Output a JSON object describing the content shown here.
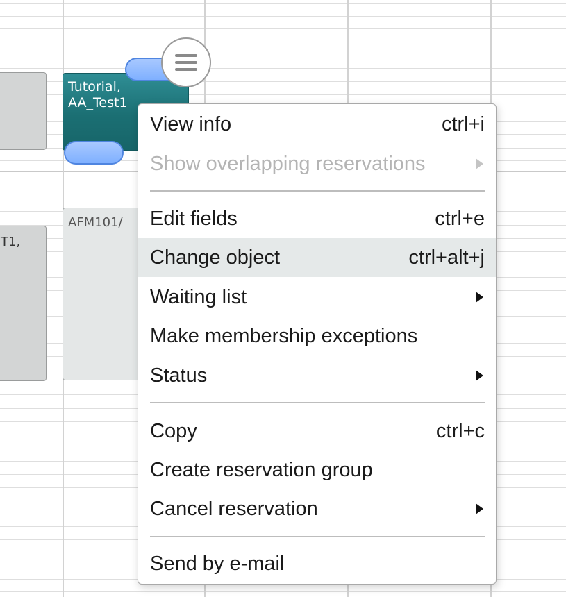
{
  "calendar": {
    "blocks": {
      "left_bottom_label": "T1,",
      "tutorial_label": "Tutorial,\nAA_Test1",
      "afm_label": "AFM101/"
    },
    "menu_toggle_icon": "hamburger-menu-icon",
    "selected_block_color": "#1b6f73",
    "handle_color": "#7fb0ff"
  },
  "context_menu": {
    "items": [
      {
        "label": "View info",
        "shortcut": "ctrl+i"
      },
      {
        "label": "Show overlapping reservations",
        "submenu_icon": "chevron-right-icon",
        "disabled": true
      },
      {
        "label": "Edit fields",
        "shortcut": "ctrl+e"
      },
      {
        "label": "Change object",
        "shortcut": "ctrl+alt+j",
        "highlighted": true
      },
      {
        "label": "Waiting list",
        "submenu_icon": "chevron-right-icon"
      },
      {
        "label": "Make membership exceptions"
      },
      {
        "label": "Status",
        "submenu_icon": "chevron-right-icon"
      },
      {
        "label": "Copy",
        "shortcut": "ctrl+c"
      },
      {
        "label": "Create reservation group"
      },
      {
        "label": "Cancel reservation",
        "submenu_icon": "chevron-right-icon"
      },
      {
        "label": "Send by e-mail"
      }
    ],
    "highlight_color": "#e5e9e9",
    "disabled_color": "#b4b4b4"
  }
}
